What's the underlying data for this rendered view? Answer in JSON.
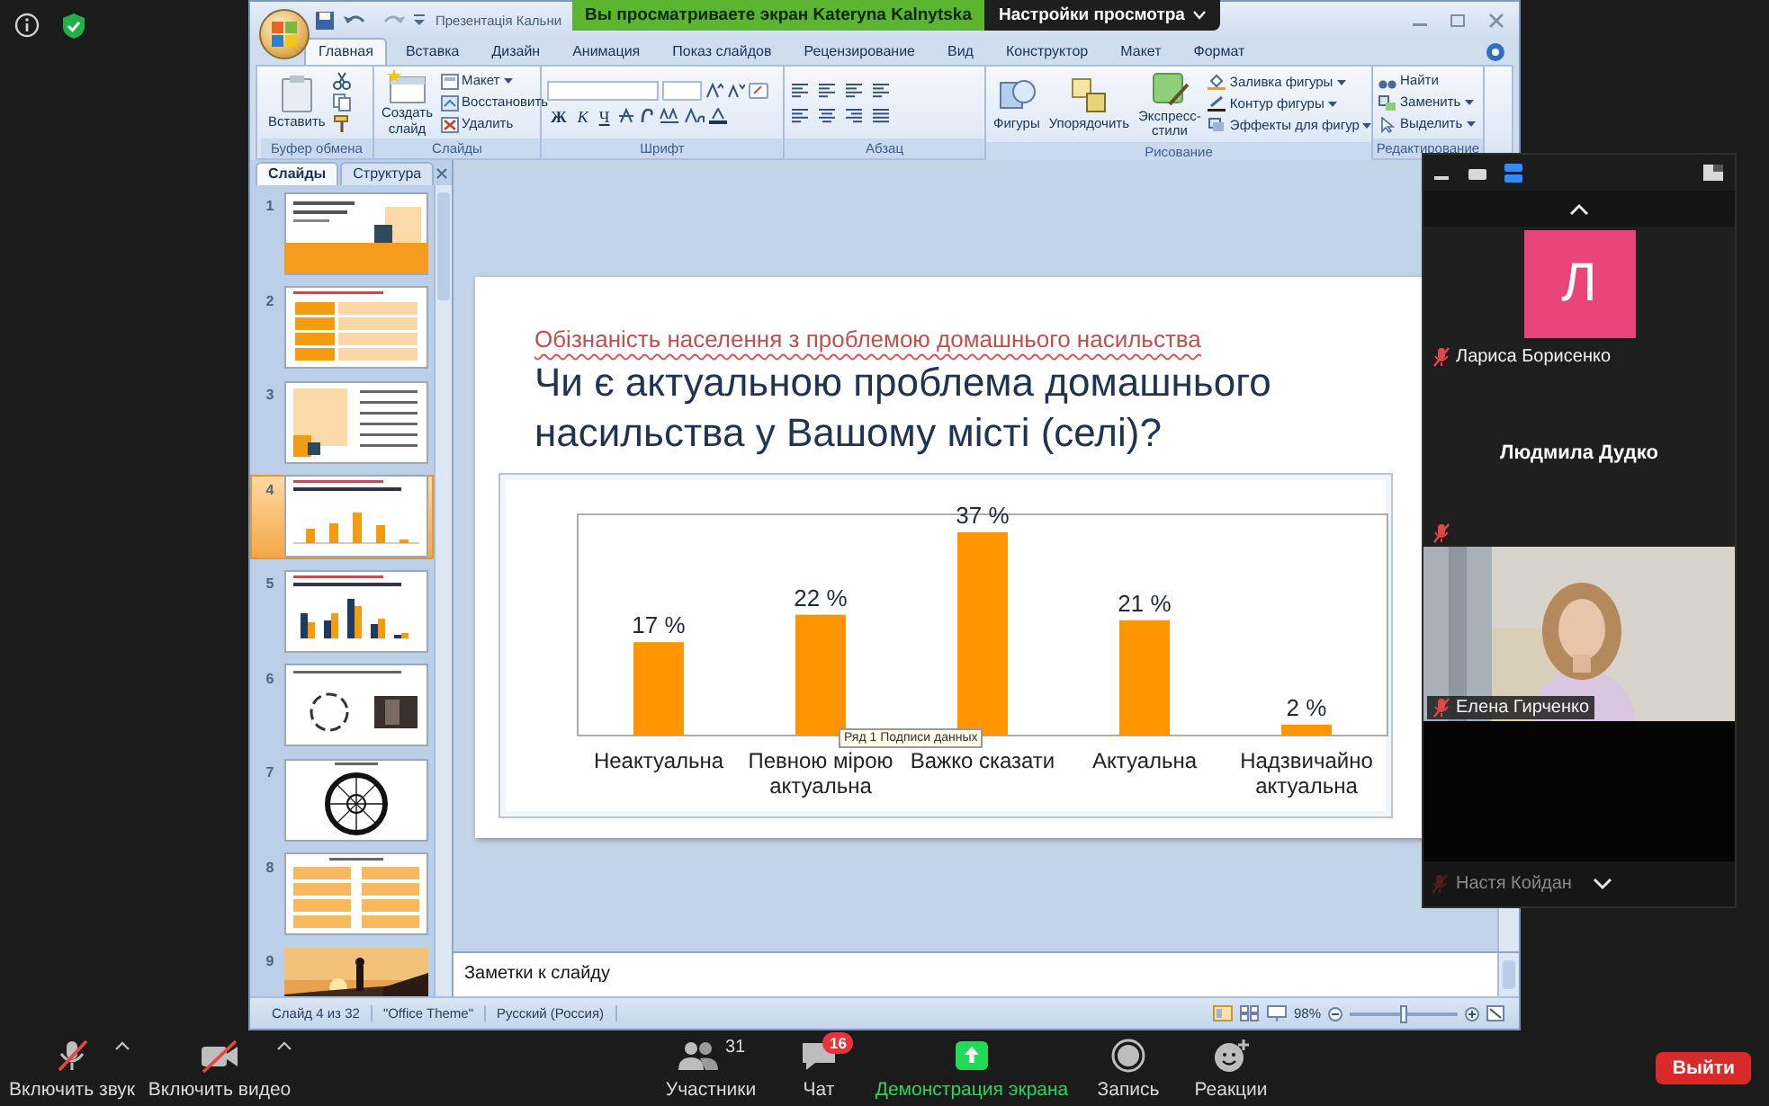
{
  "meeting": {
    "share_banner": "Вы просматриваете экран Kateryna Kalnytska",
    "view_options": "Настройки просмотра"
  },
  "powerpoint": {
    "title": "Презентація Кальни",
    "tabs": [
      {
        "label": "Главная",
        "selected": true
      },
      {
        "label": "Вставка",
        "selected": false
      },
      {
        "label": "Дизайн",
        "selected": false
      },
      {
        "label": "Анимация",
        "selected": false
      },
      {
        "label": "Показ слайдов",
        "selected": false
      },
      {
        "label": "Рецензирование",
        "selected": false
      },
      {
        "label": "Вид",
        "selected": false
      },
      {
        "label": "Конструктор",
        "selected": false
      },
      {
        "label": "Макет",
        "selected": false
      },
      {
        "label": "Формат",
        "selected": false
      }
    ],
    "ribbon_groups": [
      {
        "kind": "clipboard",
        "label": "Буфер обмена",
        "large": [
          "Вставить"
        ]
      },
      {
        "kind": "slides",
        "label": "Слайды",
        "large": [
          "Создать слайд"
        ],
        "small": [
          "Макет",
          "Восстановить",
          "Удалить"
        ]
      },
      {
        "kind": "font",
        "label": "Шрифт",
        "glyphs": [
          "Ж",
          "К",
          "Ч"
        ]
      },
      {
        "kind": "paragraph",
        "label": "Абзац"
      },
      {
        "kind": "drawing",
        "label": "Рисование",
        "large": [
          "Фигуры",
          "Упорядочить",
          "Экспресс-стили"
        ],
        "small": [
          "Заливка фигуры",
          "Контур фигуры",
          "Эффекты для фигур"
        ]
      },
      {
        "kind": "editing",
        "label": "Редактирование",
        "small": [
          "Найти",
          "Заменить",
          "Выделить"
        ]
      }
    ],
    "slides_pane": {
      "tabs": [
        {
          "label": "Слайды",
          "selected": true
        },
        {
          "label": "Структура",
          "selected": false
        }
      ],
      "thumbnails": [
        {
          "number": "1",
          "kind": "title",
          "selected": false
        },
        {
          "number": "2",
          "kind": "table",
          "selected": false
        },
        {
          "number": "3",
          "kind": "list",
          "selected": false
        },
        {
          "number": "4",
          "kind": "bars",
          "selected": true
        },
        {
          "number": "5",
          "kind": "grouped-bars",
          "selected": false
        },
        {
          "number": "6",
          "kind": "cycle",
          "selected": false
        },
        {
          "number": "7",
          "kind": "wheel",
          "selected": false
        },
        {
          "number": "8",
          "kind": "boxes",
          "selected": false
        },
        {
          "number": "9",
          "kind": "picture",
          "selected": false
        }
      ]
    },
    "slide": {
      "subtitle": "Обізнаність населення з проблемою домашнього насильства",
      "title": "Чи є актуальною проблема домашнього насильства у Вашому місті (селі)?",
      "chart_data": {
        "type": "bar",
        "categories": [
          "Неактуальна",
          "Певною мірою актуальна",
          "Важко сказати",
          "Актуальна",
          "Надзвичайно актуальна"
        ],
        "values": [
          17,
          22,
          37,
          21,
          2
        ],
        "value_labels": [
          "17 %",
          "22 %",
          "37 %",
          "21 %",
          "2 %"
        ]
      },
      "tooltip": "Ряд 1 Подписи данных"
    },
    "notes": {
      "placeholder": "Заметки к слайду"
    },
    "status_bar": {
      "items": [
        "Слайд 4 из 32",
        "\"Office Theme\"",
        "Русский (Россия)"
      ],
      "zoom": "98%",
      "zoom_slider": {
        "level": 0.5
      }
    }
  },
  "participants_panel": {
    "tiles": [
      {
        "kind": "avatar",
        "initial": "Л",
        "name": "Лариса Борисенко",
        "muted": true
      },
      {
        "kind": "name",
        "name": "Людмила Дудко",
        "muted": true
      },
      {
        "kind": "video",
        "name": "Елена Гирченко",
        "muted": true
      },
      {
        "kind": "dim",
        "name": "Настя Койдан",
        "muted": true
      }
    ]
  },
  "toolbar": {
    "left": [
      {
        "kind": "audio",
        "label": "Включить звук",
        "off": true
      },
      {
        "kind": "video",
        "label": "Включить видео",
        "off": true
      }
    ],
    "center": [
      {
        "kind": "participants",
        "label": "Участники",
        "count": "31"
      },
      {
        "kind": "chat",
        "label": "Чат",
        "badge": "16"
      },
      {
        "kind": "share",
        "label": "Демонстрация экрана"
      },
      {
        "kind": "record",
        "label": "Запись"
      },
      {
        "kind": "reactions",
        "label": "Реакции"
      }
    ],
    "leave": "Выйти"
  }
}
